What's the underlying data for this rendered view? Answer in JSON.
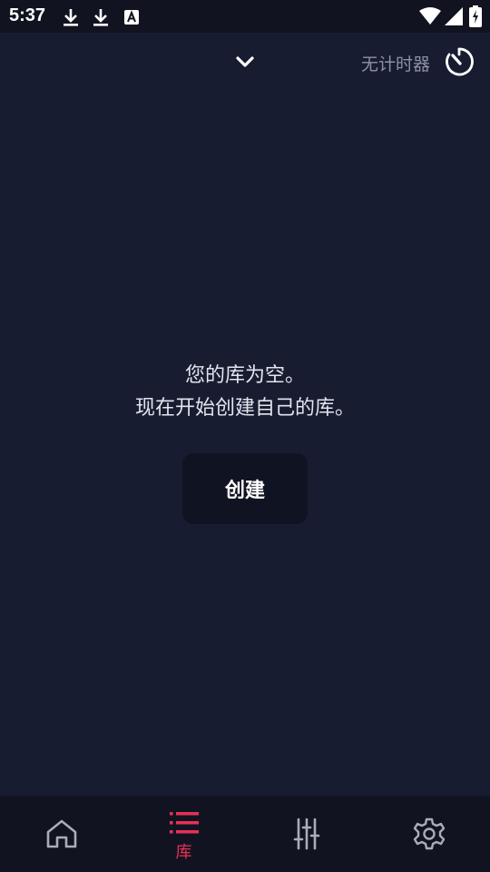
{
  "status_bar": {
    "time": "5:37",
    "icons": [
      "download-icon",
      "download-icon",
      "keyboard-a-icon",
      "wifi-icon",
      "signal-icon",
      "battery-charging-icon"
    ]
  },
  "top_bar": {
    "collapse_icon": "chevron-down-icon",
    "timer_label": "无计时器",
    "timer_icon": "timer-icon"
  },
  "empty_state": {
    "line1": "您的库为空。",
    "line2": "现在开始创建自己的库。",
    "create_label": "创建"
  },
  "bottom_nav": {
    "items": [
      {
        "icon": "home-icon",
        "label": "",
        "active": false
      },
      {
        "icon": "list-icon",
        "label": "库",
        "active": true
      },
      {
        "icon": "equalizer-icon",
        "label": "",
        "active": false
      },
      {
        "icon": "settings-icon",
        "label": "",
        "active": false
      }
    ]
  },
  "colors": {
    "background": "#181c30",
    "bars": "#111420",
    "accent": "#e8305a",
    "muted_text": "#8d91a3",
    "button_bg": "#101321"
  }
}
